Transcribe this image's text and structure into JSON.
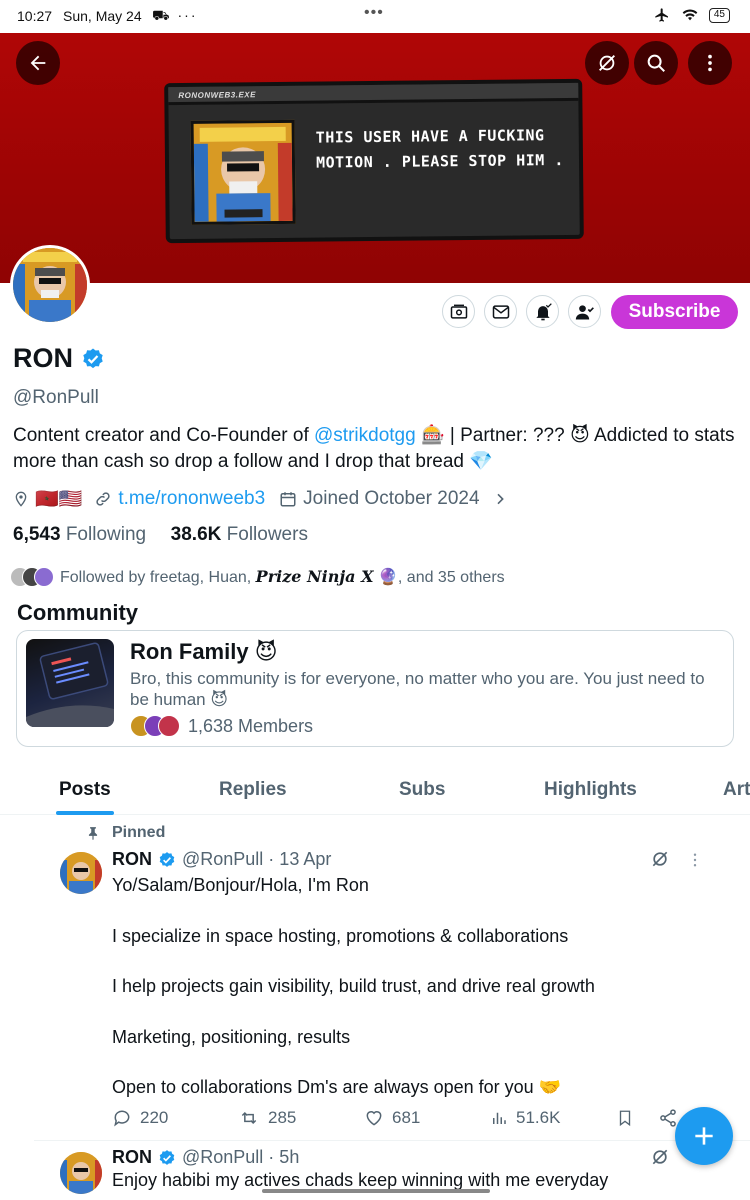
{
  "status_bar": {
    "time": "10:27",
    "date": "Sun, May 24",
    "left_icons": "⛟ ···",
    "center_dots": "•••",
    "battery": "45"
  },
  "banner": {
    "window_title": "RONONWEB3.EXE",
    "message_line1": "THIS USER HAVE A FUCKING",
    "message_line2": "MOTION . PLEASE STOP HIM ."
  },
  "profile": {
    "name": "RON",
    "handle": "@RonPull",
    "bio_part1": "Content creator and Co-Founder of ",
    "bio_link": "@strikdotgg",
    "bio_part2": " 🎰 | Partner: ??? 😈  Addicted to stats more than cash so drop a follow and I drop that bread 💎",
    "location_flags": "🇲🇦🇺🇸",
    "website": "t.me/rononweeb3",
    "joined": "Joined October 2024",
    "following_count": "6,543",
    "following_label": "Following",
    "followers_count": "38.6K",
    "followers_label": "Followers",
    "followed_by_prefix": "Followed by freetag, Huan, ",
    "followed_by_name": "Prize Ninja X",
    "followed_by_suffix": " 🔮, and 35 others"
  },
  "buttons": {
    "subscribe": "Subscribe"
  },
  "community": {
    "section_title": "Community",
    "name": "Ron Family 😈",
    "description": "Bro, this community is for everyone, no matter who you are. You just need to be human 😈",
    "members": "1,638 Members"
  },
  "tabs": [
    {
      "label": "Posts"
    },
    {
      "label": "Replies"
    },
    {
      "label": "Subs"
    },
    {
      "label": "Highlights"
    },
    {
      "label": "Art"
    }
  ],
  "pinned_label": "Pinned",
  "posts": [
    {
      "name": "RON",
      "handle_time": "@RonPull · 13 Apr",
      "lines": [
        "Yo/Salam/Bonjour/Hola, I'm Ron",
        "",
        "I specialize in space hosting, promotions & collaborations",
        "",
        "I help projects gain visibility, build trust, and drive real growth",
        "",
        "Marketing, positioning, results",
        "",
        "Open to collaborations Dm's are always open for you 🤝"
      ],
      "replies": "220",
      "reposts": "285",
      "likes": "681",
      "views": "51.6K"
    },
    {
      "name": "RON",
      "handle_time": "@RonPull · 5h",
      "text": "Enjoy habibi my actives chads keep winning with me everyday"
    }
  ],
  "colors": {
    "accent": "#1d9bf0",
    "subscribe": "#c936d8",
    "banner": "#b00606"
  }
}
